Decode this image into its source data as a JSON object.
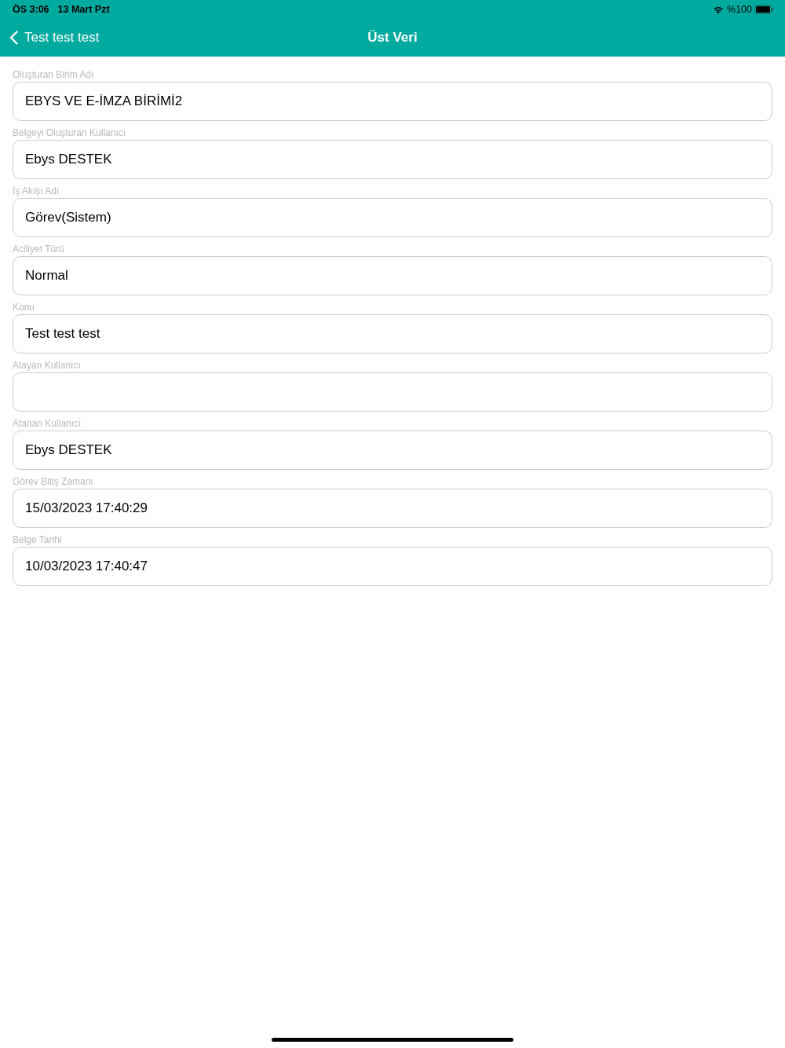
{
  "status_bar": {
    "time": "ÖS 3:06",
    "date": "13 Mart Pzt",
    "battery_text": "%100"
  },
  "nav_bar": {
    "back_label": "Test test test",
    "title": "Üst Veri"
  },
  "fields": [
    {
      "label": "Oluşturan Birim Adı",
      "value": "EBYS VE E-İMZA BİRİMİ2"
    },
    {
      "label": "Belgeyi Oluşturan Kullanıcı",
      "value": "Ebys DESTEK"
    },
    {
      "label": "İş Akışı Adı",
      "value": "Görev(Sistem)"
    },
    {
      "label": "Aciliyet Türü",
      "value": "Normal"
    },
    {
      "label": "Konu",
      "value": "Test test test"
    },
    {
      "label": "Atayan Kullanıcı"
    },
    {
      "label": "Atanan Kullanıcı",
      "value": "Ebys DESTEK"
    },
    {
      "label": "Görev Bitiş Zamanı",
      "value": "15/03/2023 17:40:29"
    },
    {
      "label": "Belge Tarihi",
      "value": "10/03/2023 17:40:47"
    }
  ]
}
